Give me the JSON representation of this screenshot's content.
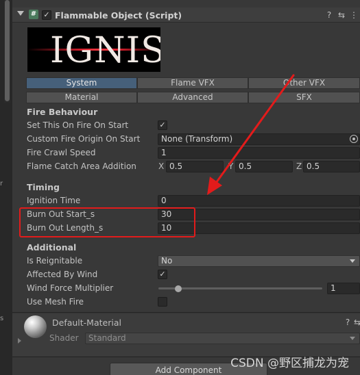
{
  "component": {
    "title": "Flammable Object (Script)",
    "enabled_check": "✓",
    "icons": {
      "help": "?",
      "presets": "⇆",
      "menu": "⋮"
    }
  },
  "logo": {
    "text": "IGNIS"
  },
  "tabs_row1": [
    "System",
    "Flame VFX",
    "Other VFX"
  ],
  "tabs_row2": [
    "Material",
    "Advanced",
    "SFX"
  ],
  "active_tab": "System",
  "fire_behaviour": {
    "heading": "Fire Behaviour",
    "set_on_fire_label": "Set This On Fire On Start",
    "set_on_fire_value": "✓",
    "origin_label": "Custom Fire Origin On Start",
    "origin_value": "None (Transform)",
    "crawl_label": "Fire Crawl Speed",
    "crawl_value": "1",
    "catch_label": "Flame Catch Area Addition",
    "catch_x_label": "X",
    "catch_x": "0.5",
    "catch_y_label": "Y",
    "catch_y": "0.5",
    "catch_z_label": "Z",
    "catch_z": "0.5"
  },
  "timing": {
    "heading": "Timing",
    "ignition_label": "Ignition Time",
    "ignition_value": "0",
    "burn_start_label": "Burn Out Start_s",
    "burn_start_value": "30",
    "burn_length_label": "Burn Out Length_s",
    "burn_length_value": "10"
  },
  "additional": {
    "heading": "Additional",
    "reignitable_label": "Is Reignitable",
    "reignitable_value": "No",
    "wind_label": "Affected By Wind",
    "wind_value": "✓",
    "wind_force_label": "Wind Force Multiplier",
    "wind_force_value": "1",
    "wind_force_slider": 0.12,
    "mesh_fire_label": "Use Mesh Fire"
  },
  "material": {
    "name": "Default-Material",
    "shader_label": "Shader",
    "shader_value": "Standard"
  },
  "add_component": "Add Component",
  "watermark": "CSDN @野区捕龙为宠",
  "colors": {
    "highlight": "#e31b1b",
    "active_tab": "#46607a"
  }
}
